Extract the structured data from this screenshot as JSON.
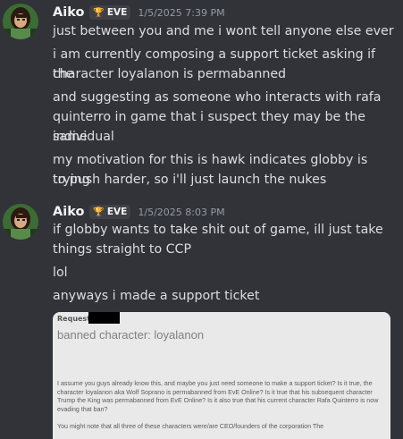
{
  "colors": {
    "background": "#313338",
    "username": "#f2f3f5",
    "text": "#dbdee1",
    "timestamp": "#949ba4",
    "tag_bg": "#3f4147",
    "embed_bg": "#e9e9e9"
  },
  "messages": [
    {
      "author": "Aiko",
      "tag_icon": "trophy-icon",
      "tag": "EVE",
      "timestamp": "1/5/2025 7:39 PM",
      "lines": [
        "just between you and me i wont tell anyone else ever",
        "i am currently composing a support ticket asking if the",
        "character loyalanon is permabanned",
        "and suggesting as someone who interacts with rafa",
        "quinterro in game that i suspect they may be the same",
        "individual",
        "my motivation for this is hawk indicates globby is trying",
        "to push harder, so i'll just launch the nukes"
      ]
    },
    {
      "author": "Aiko",
      "tag_icon": "trophy-icon",
      "tag": "EVE",
      "timestamp": "1/5/2025 8:03 PM",
      "lines": [
        "if globby wants to take shit out of game, ill just take",
        "things straight to CCP",
        "lol",
        "anyways i made a support ticket"
      ]
    }
  ],
  "attachment": {
    "request_label": "Request",
    "title": "banned character: loyalanon",
    "paragraphs": [
      "I assume you guys already know this, and maybe you just need someone to make a support ticket? Is it true, the character loyalanon aka Wolf Soprano is permabanned from EvE Online? Is it true that his subsequent character Trump the King was permabanned from EvE Online? Is it also true that his current character Rafa Quinterro is now evading that ban?",
      "You might note that all three of these characters were/are CEO/founders of the corporation The"
    ]
  }
}
